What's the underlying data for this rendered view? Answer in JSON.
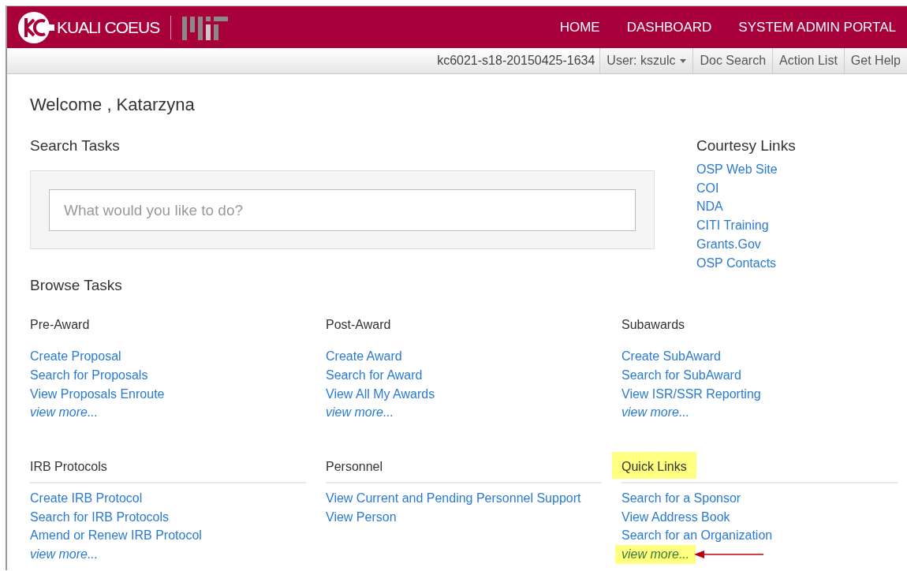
{
  "header": {
    "brand": "KUALI COEUS",
    "nav": [
      {
        "label": "HOME"
      },
      {
        "label": "DASHBOARD"
      },
      {
        "label": "SYSTEM ADMIN PORTAL"
      }
    ]
  },
  "toolbar": {
    "environment": "kc6021-s18-20150425-1634",
    "user_menu": "User: kszulc",
    "buttons": [
      "Doc Search",
      "Action List",
      "Get Help"
    ]
  },
  "welcome": "Welcome , Katarzyna",
  "search_tasks": {
    "title": "Search Tasks",
    "placeholder": "What would you like to do?"
  },
  "courtesy_links": {
    "title": "Courtesy Links",
    "links": [
      "OSP Web Site",
      "COI",
      "NDA",
      "CITI Training",
      "Grants.Gov",
      "OSP Contacts"
    ]
  },
  "browse_tasks": {
    "title": "Browse Tasks",
    "sections": [
      {
        "title": "Pre-Award",
        "underlined": false,
        "highlighted": false,
        "links": [
          "Create Proposal",
          "Search for Proposals",
          "View Proposals Enroute"
        ],
        "view_more": {
          "label": "view more...",
          "highlighted": false,
          "arrow": false
        }
      },
      {
        "title": "Post-Award",
        "underlined": false,
        "highlighted": false,
        "links": [
          "Create Award",
          "Search for Award",
          "View All My Awards"
        ],
        "view_more": {
          "label": "view more...",
          "highlighted": false,
          "arrow": false
        }
      },
      {
        "title": "Subawards",
        "underlined": false,
        "highlighted": false,
        "links": [
          "Create SubAward",
          "Search for SubAward",
          "View ISR/SSR Reporting"
        ],
        "view_more": {
          "label": "view more...",
          "highlighted": false,
          "arrow": false
        }
      },
      {
        "title": "IRB Protocols",
        "underlined": true,
        "highlighted": false,
        "links": [
          "Create IRB Protocol",
          "Search for IRB Protocols",
          "Amend or Renew IRB Protocol"
        ],
        "view_more": {
          "label": "view more...",
          "highlighted": false,
          "arrow": false
        }
      },
      {
        "title": "Personnel",
        "underlined": true,
        "highlighted": false,
        "links": [
          "View Current and Pending Personnel Support",
          "View Person"
        ]
      },
      {
        "title": "Quick Links",
        "underlined": true,
        "highlighted": true,
        "links": [
          "Search for a Sponsor",
          "View Address Book",
          "Search for an Organization"
        ],
        "view_more": {
          "label": "view more...",
          "highlighted": true,
          "arrow": true
        }
      }
    ]
  }
}
